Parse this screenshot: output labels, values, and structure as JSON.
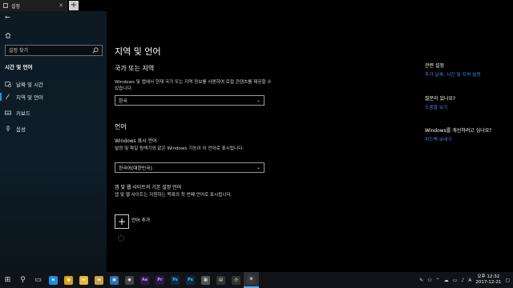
{
  "window": {
    "tab_title": "설정",
    "tab_close": "✕",
    "new_tab": "+"
  },
  "sidebar": {
    "back_glyph": "←",
    "search_placeholder": "설정 찾기",
    "section_title": "시간 및 언어",
    "items": [
      {
        "label": "날짜 및 시간",
        "icon": "calendar-clock-icon"
      },
      {
        "label": "지역 및 언어",
        "icon": "pen-globe-icon",
        "active": true
      },
      {
        "label": "키보드",
        "icon": "keyboard-icon"
      },
      {
        "label": "음성",
        "icon": "microphone-icon"
      }
    ]
  },
  "main": {
    "title": "지역 및 언어",
    "region": {
      "heading": "국가 또는 지역",
      "description": "Windows 및 앱에서 현재 국가 또는 지역 정보를 사용하여 로컬 콘텐츠를 제공할 수 있습니다.",
      "value": "한국"
    },
    "language": {
      "heading": "언어",
      "display_label": "Windows 표시 언어",
      "display_description": "설정 및 파일 탐색기와 같은 Windows 기능이 이 언어로 표시됩니다.",
      "display_value": "한국어(대한민국)",
      "preferred_label": "앱 및 웹 사이트의 기본 설정 언어",
      "preferred_description": "앱 및 웹 사이트는 지원하는 목록의 첫 번째 언어로 표시됩니다.",
      "add_label": "언어 추가",
      "add_glyph": "+"
    }
  },
  "rail": {
    "related_heading": "관련 설정",
    "related_link": "추가 날짜, 시간 및 지역 설정",
    "question_heading": "질문이 있나요?",
    "help_link": "도움말 보기",
    "improve_heading": "Windows를 개선하려고 십나요?",
    "feedback_link": "피드백 보내기"
  },
  "taskbar": {
    "start_glyph": "⊞",
    "search_glyph": "⚲",
    "taskview_glyph": "▭",
    "apps": [
      {
        "name": "edge",
        "text": "e",
        "color": "#1d8fe1"
      },
      {
        "name": "chrome",
        "text": "●",
        "color": "#d9a21a"
      },
      {
        "name": "file-explorer",
        "text": "▬",
        "color": "#e8b936"
      },
      {
        "name": "folder",
        "text": "▬",
        "color": "#caa14a"
      },
      {
        "name": "store",
        "text": "▣",
        "color": "#2b6fb5"
      },
      {
        "name": "camera",
        "text": "◉",
        "color": "#444"
      },
      {
        "name": "after-effects",
        "text": "Ae",
        "color": "#2c1a4d"
      },
      {
        "name": "premiere",
        "text": "Pr",
        "color": "#2c1a4d"
      },
      {
        "name": "photoshop",
        "text": "Ps",
        "color": "#0f2a44"
      },
      {
        "name": "photoshop-2",
        "text": "Ps",
        "color": "#0f2a44"
      },
      {
        "name": "calculator",
        "text": "▦",
        "color": "#555"
      },
      {
        "name": "film",
        "text": "▤",
        "color": "#333"
      },
      {
        "name": "clock-app",
        "text": "◷",
        "color": "#333"
      },
      {
        "name": "settings",
        "text": "⚙",
        "color": "#3a3a3a",
        "active": true
      }
    ],
    "time": "오후 12:32",
    "date": "2017-12-21"
  }
}
